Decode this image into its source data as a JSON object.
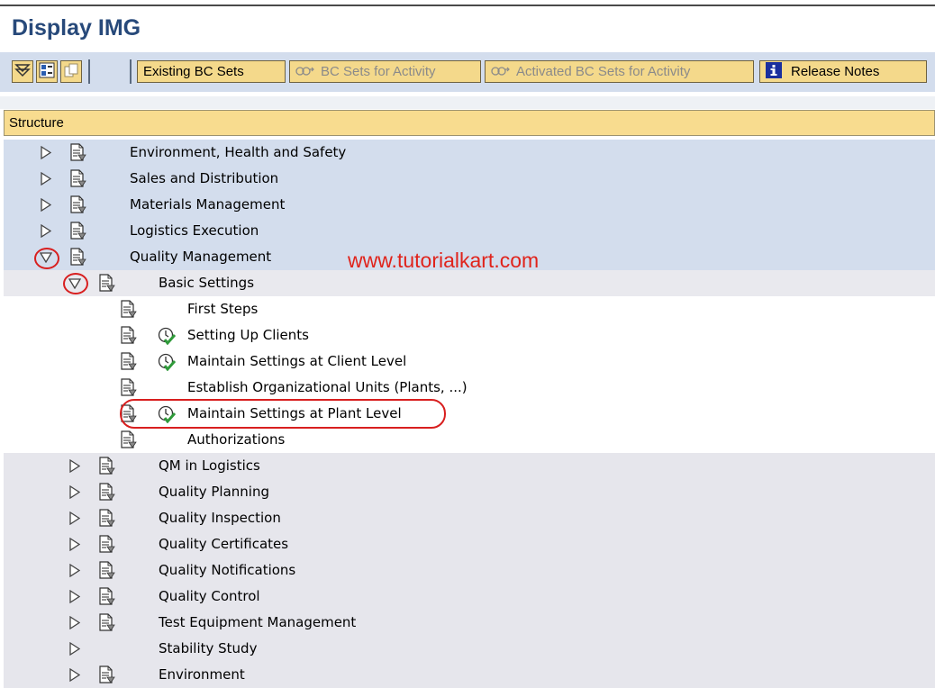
{
  "window": {
    "title": "Display IMG"
  },
  "toolbar": {
    "existing_bc_sets": "Existing BC Sets",
    "bc_sets_for_activity": "BC Sets for Activity",
    "activated_bc_sets": "Activated BC Sets for Activity",
    "release_notes": "Release Notes",
    "icons": [
      "expand-all-icon",
      "tree-info-icon",
      "copy-icon",
      "bc-set-icon",
      "info-icon"
    ]
  },
  "structure": {
    "header": "Structure",
    "watermark": "www.tutorialkart.com",
    "nodes": [
      {
        "label": "Environment, Health and Safety",
        "level": 0,
        "state": "collapsed"
      },
      {
        "label": "Sales and Distribution",
        "level": 0,
        "state": "collapsed"
      },
      {
        "label": "Materials Management",
        "level": 0,
        "state": "collapsed"
      },
      {
        "label": "Logistics Execution",
        "level": 0,
        "state": "collapsed"
      },
      {
        "label": "Quality Management",
        "level": 0,
        "state": "expanded"
      },
      {
        "label": "Basic Settings",
        "level": 1,
        "state": "expanded"
      },
      {
        "label": "First Steps",
        "level": 2,
        "state": "leaf",
        "executable": false
      },
      {
        "label": "Setting Up Clients",
        "level": 2,
        "state": "leaf",
        "executable": true
      },
      {
        "label": "Maintain Settings at Client Level",
        "level": 2,
        "state": "leaf",
        "executable": true
      },
      {
        "label": "Establish Organizational Units (Plants, ...)",
        "level": 2,
        "state": "leaf",
        "executable": false
      },
      {
        "label": "Maintain Settings at Plant Level",
        "level": 2,
        "state": "leaf",
        "executable": true,
        "highlighted": true
      },
      {
        "label": "Authorizations",
        "level": 2,
        "state": "leaf",
        "executable": false
      },
      {
        "label": "QM in Logistics",
        "level": 1,
        "state": "collapsed"
      },
      {
        "label": "Quality Planning",
        "level": 1,
        "state": "collapsed"
      },
      {
        "label": "Quality Inspection",
        "level": 1,
        "state": "collapsed"
      },
      {
        "label": "Quality Certificates",
        "level": 1,
        "state": "collapsed"
      },
      {
        "label": "Quality Notifications",
        "level": 1,
        "state": "collapsed"
      },
      {
        "label": "Quality Control",
        "level": 1,
        "state": "collapsed"
      },
      {
        "label": "Test Equipment Management",
        "level": 1,
        "state": "collapsed"
      },
      {
        "label": "Stability Study",
        "level": 1,
        "state": "collapsed",
        "no_doc": true
      },
      {
        "label": "Environment",
        "level": 1,
        "state": "collapsed"
      }
    ]
  },
  "colors": {
    "title": "#27497a",
    "toolbar_bg": "#d3dded",
    "button_bg": "#f4d98b",
    "header_bg": "#f8dc8f",
    "highlight_red": "#d81f1f"
  }
}
